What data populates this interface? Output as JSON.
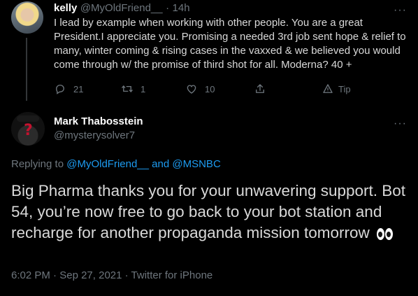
{
  "previous_tweet": {
    "name": "kelly",
    "handle": "@MyOldFriend__",
    "time": "14h",
    "text": "I lead by example when working with other people. You are a great President.I appreciate you. Promising a needed 3rd job sent hope & relief to many, winter coming & rising cases in the vaxxed & we believed you would come through w/ the promise of third shot for all. Moderna? 40 +",
    "actions": {
      "reply_count": "21",
      "retweet_count": "1",
      "like_count": "10",
      "tip_label": "Tip"
    }
  },
  "main_tweet": {
    "name": "Mark Thabosstein",
    "handle": "@mysterysolver7",
    "replying_prefix": "Replying to",
    "replying_user_1": "@MyOldFriend__",
    "replying_and": "and",
    "replying_user_2": "@MSNBC",
    "text": "Big Pharma thanks you for your unwavering support. Bot 54, you’re now free to go back to your bot station and recharge for another propaganda mission tomorrow",
    "time": "6:02 PM",
    "date": "Sep 27, 2021",
    "source": "Twitter for iPhone"
  },
  "icons": {
    "more": "more-icon",
    "reply": "reply-icon",
    "retweet": "retweet-icon",
    "like": "like-icon",
    "share": "share-icon",
    "tip": "tip-icon",
    "eyes_emoji": "eyes-emoji-icon"
  },
  "colors": {
    "background": "#000000",
    "link": "#1d9bf0",
    "muted": "#6e767d"
  }
}
